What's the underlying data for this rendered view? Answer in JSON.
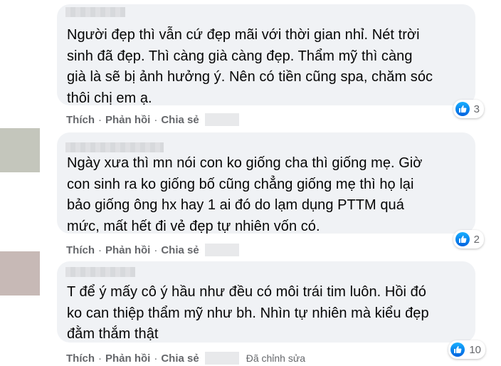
{
  "comments": [
    {
      "text": "Người đẹp thì vẫn cứ đẹp mãi với thời gian nhỉ. Nét trời\nsinh đã đẹp. Thì càng già càng đẹp. Thẩm mỹ thì càng\ngià là sẽ bị ảnh hưởng ý. Nên có tiền cũng spa, chăm sóc\nthôi chị em ạ.",
      "reaction_count": "3",
      "like_label": "Thích",
      "reply_label": "Phản hồi",
      "share_label": "Chia sẻ",
      "avatar_color": "#ffffff"
    },
    {
      "text": "Ngày xưa thì mn nói con ko giống cha thì giống mẹ. Giờ\ncon sinh ra ko giống bố cũng chẳng giống mẹ thì họ lại\nbảo giống ông hx hay 1 ai đó do lạm dụng PTTM quá\nmức, mất hết đi vẻ đẹp tự nhiên vốn có.",
      "reaction_count": "2",
      "like_label": "Thích",
      "reply_label": "Phản hồi",
      "share_label": "Chia sẻ",
      "avatar_color": "#c4c6bc"
    },
    {
      "text": "T để ý mấy cô ý hầu như đều có môi trái tim luôn. Hồi đó\nko can thiệp thẩm mỹ như bh. Nhìn tự nhiên mà kiểu đẹp\nđằm thắm thật",
      "reaction_count": "10",
      "like_label": "Thích",
      "reply_label": "Phản hồi",
      "share_label": "Chia sẻ",
      "edited_label": "Đã chỉnh sửa",
      "avatar_color": "#c7b9b6"
    }
  ],
  "separator": "·",
  "colors": {
    "bubble": "#f0f2f5",
    "text": "#050505",
    "meta": "#65676b",
    "like_blue": "#1877f2"
  },
  "icons": [
    "thumbs-up-icon"
  ]
}
